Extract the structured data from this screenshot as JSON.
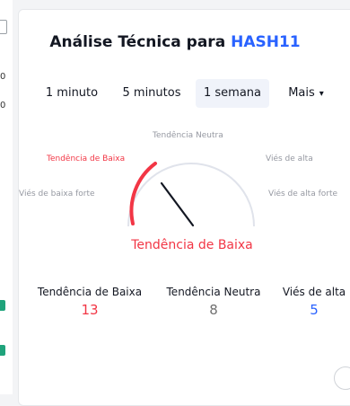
{
  "left_fragments": {
    "row1": "0",
    "row2": "0"
  },
  "panel": {
    "title_prefix": "Análise Técnica para",
    "title_symbol": "HASH11"
  },
  "tabs": [
    {
      "label": "1 minuto",
      "active": false
    },
    {
      "label": "5 minutos",
      "active": false
    },
    {
      "label": "1 semana",
      "active": true
    },
    {
      "label": "Mais",
      "active": false
    }
  ],
  "gauge": {
    "labels": {
      "neutral": "Tendência Neutra",
      "sell": "Tendência de Baixa",
      "buy": "Viés de alta",
      "strong_sell": "Viés de baixa forte",
      "strong_buy": "Viés de alta forte"
    },
    "result": "Tendência de Baixa",
    "colors": {
      "sell": "#f23645",
      "track": "#e0e3eb",
      "needle": "#131722"
    }
  },
  "summary": [
    {
      "name": "Tendência de Baixa",
      "value": "13",
      "color": "#f23645"
    },
    {
      "name": "Tendência Neutra",
      "value": "8",
      "color": "#707070"
    },
    {
      "name": "Viés de alta",
      "value": "5",
      "color": "#2962ff"
    }
  ]
}
